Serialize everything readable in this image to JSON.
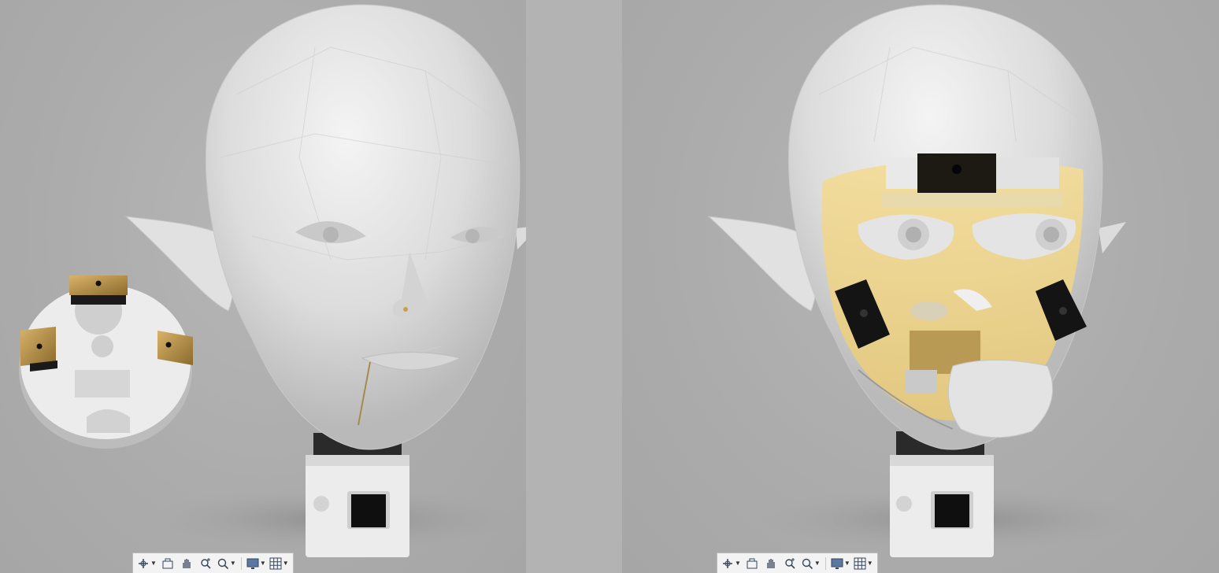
{
  "app": {
    "toolbar_tools": [
      {
        "name": "orbit",
        "icon": "orbit-icon",
        "has_dropdown": true
      },
      {
        "name": "look-at",
        "icon": "look-at-icon",
        "has_dropdown": false
      },
      {
        "name": "pan",
        "icon": "pan-hand-icon",
        "has_dropdown": false
      },
      {
        "name": "zoom",
        "icon": "zoom-icon",
        "has_dropdown": false
      },
      {
        "name": "fit",
        "icon": "zoom-window-icon",
        "has_dropdown": true
      },
      {
        "name": "display-settings",
        "icon": "display-monitor-icon",
        "has_dropdown": true
      },
      {
        "name": "grid-and-snaps",
        "icon": "grid-icon",
        "has_dropdown": true
      }
    ],
    "colors": {
      "background": "#adadad",
      "model_white": "#e6e6e6",
      "gold_plate": "#b8924a",
      "translucent_yellow": "#f0d68a",
      "black_part": "#161616",
      "toolbar_bg": "#f3f3f3",
      "toolbar_icon": "#33465e"
    }
  }
}
